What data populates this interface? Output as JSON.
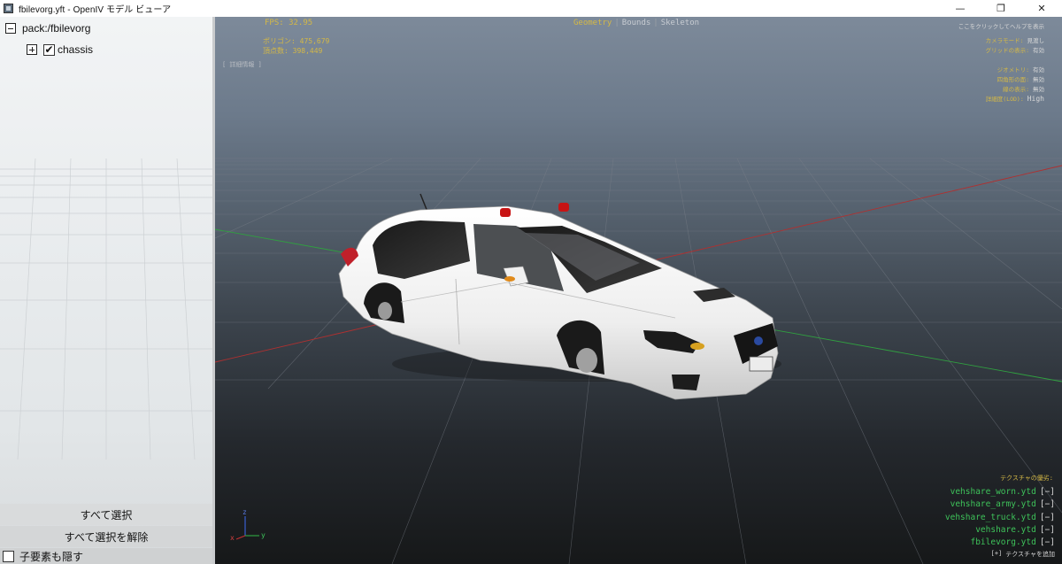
{
  "window": {
    "title": "fbilevorg.yft - OpenIV モデル ビューア",
    "minimize": "—",
    "restore": "❐",
    "close": "✕"
  },
  "tree": {
    "root_label": "pack:/fbilevorg",
    "child_label": "chassis",
    "child_checked": "✔"
  },
  "left_buttons": {
    "select_all": "すべて選択",
    "deselect_all": "すべて選択を解除",
    "hide_children": "子要素も隠す"
  },
  "hud": {
    "fps": "FPS: 32.95",
    "polygons": "ポリゴン: 475,679",
    "vertices": "頂点数: 398,449",
    "details": "[ 詳細情報 ]",
    "help_hint": "ここをクリックしてヘルプを表示",
    "modes": {
      "geometry": "Geometry",
      "bounds": "Bounds",
      "skeleton": "Skeleton"
    },
    "options": [
      {
        "label": "カメラモード:",
        "value": "見渡し"
      },
      {
        "label": "グリッドの表示:",
        "value": "有効"
      },
      {
        "label": "ジオメトリ:",
        "value": "有効"
      },
      {
        "label": "四角形の面:",
        "value": "無効"
      },
      {
        "label": "線の表示:",
        "value": "無効"
      },
      {
        "label": "詳細度(LOD):",
        "value": "High"
      }
    ],
    "texture_header": "テクスチャの優劣:",
    "textures": [
      {
        "name": "vehshare_worn.ytd",
        "action": "[−]"
      },
      {
        "name": "vehshare_army.ytd",
        "action": "[−]"
      },
      {
        "name": "vehshare_truck.ytd",
        "action": "[−]"
      },
      {
        "name": "vehshare.ytd",
        "action": "[−]"
      },
      {
        "name": "fbilevorg.ytd",
        "action": "[−]"
      }
    ],
    "add_texture_btn": "[+]",
    "add_texture_label": "テクスチャを追加",
    "axis": {
      "x": "x",
      "y": "y",
      "z": "z"
    }
  },
  "colors": {
    "hud_yellow": "#d4b846",
    "hud_green": "#3ec25a",
    "viewport_top": "#7d8a9a",
    "viewport_bottom": "#161819",
    "car_body": "#f2f2f2",
    "beacon": "#c81414"
  }
}
